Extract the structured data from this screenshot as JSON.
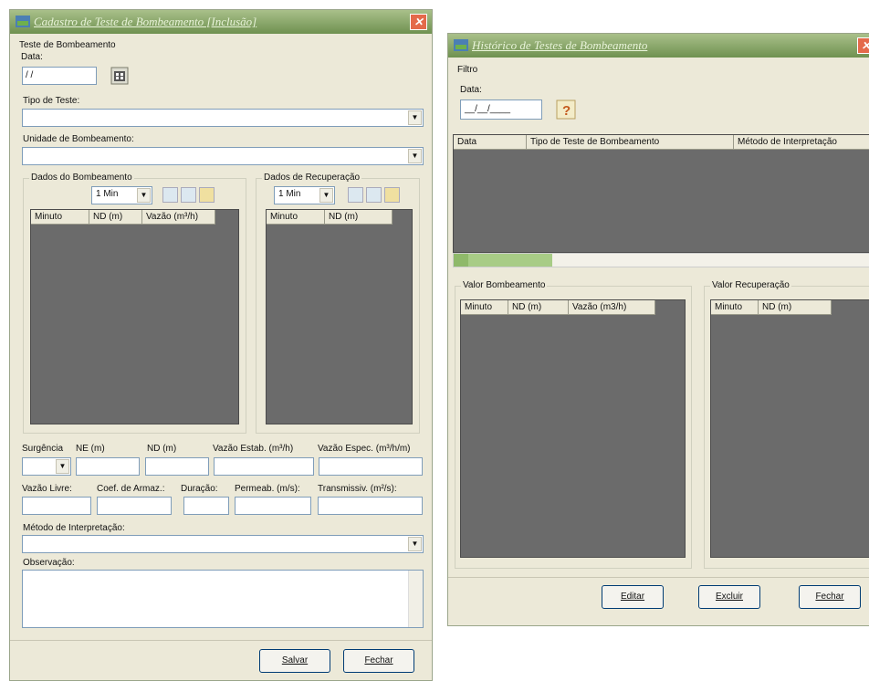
{
  "left_window": {
    "title": "Cadastro de Teste de Bombeamento [Inclusão]",
    "group_title": "Teste de Bombeamento",
    "date_label": "Data:",
    "date_value": " / /",
    "test_type_label": "Tipo de Teste:",
    "pumping_unit_label": "Unidade de Bombeamento:",
    "pumping_data": {
      "title": "Dados do Bombeamento",
      "interval": "1 Min",
      "columns": [
        "Minuto",
        "ND (m)",
        "Vazão (m³/h)"
      ]
    },
    "recovery_data": {
      "title": "Dados de Recuperação",
      "interval": "1 Min",
      "columns": [
        "Minuto",
        "ND (m)"
      ]
    },
    "fields_row1": {
      "surgencia": "Surgência",
      "ne": "NE (m)",
      "nd": "ND (m)",
      "vazao_estab": "Vazão Estab. (m³/h)",
      "vazao_espec": "Vazão Espec. (m³/h/m)"
    },
    "fields_row2": {
      "vazao_livre": "Vazão Livre:",
      "coef_armaz": "Coef. de Armaz.:",
      "duracao": "Duração:",
      "permeab": "Permeab. (m/s):",
      "transmissiv": "Transmissiv. (m²/s):"
    },
    "method_label": "Método de Interpretação:",
    "observation_label": "Observação:",
    "save_button": "Salvar",
    "close_button": "Fechar"
  },
  "right_window": {
    "title": "Histórico de Testes de Bombeamento",
    "filter_label": "Filtro",
    "date_label": "Data:",
    "date_value": "__/__/____",
    "history_columns": [
      "Data",
      "Tipo de Teste de Bombeamento",
      "Método de Interpretação"
    ],
    "pumping_values": {
      "title": "Valor Bombeamento",
      "columns": [
        "Minuto",
        "ND (m)",
        "Vazão (m3/h)"
      ]
    },
    "recovery_values": {
      "title": "Valor Recuperação",
      "columns": [
        "Minuto",
        "ND (m)"
      ]
    },
    "edit_button": "Editar",
    "delete_button": "Excluir",
    "close_button": "Fechar"
  },
  "colors": {
    "titlebar": "#6f9150",
    "close": "#e46a4b",
    "grid": "#6b6b6b",
    "window": "#ece9d8"
  },
  "icons": [
    "app-icon",
    "close-icon",
    "calendar-icon",
    "help-icon",
    "add-row-icon",
    "remove-row-icon",
    "chart-icon"
  ]
}
